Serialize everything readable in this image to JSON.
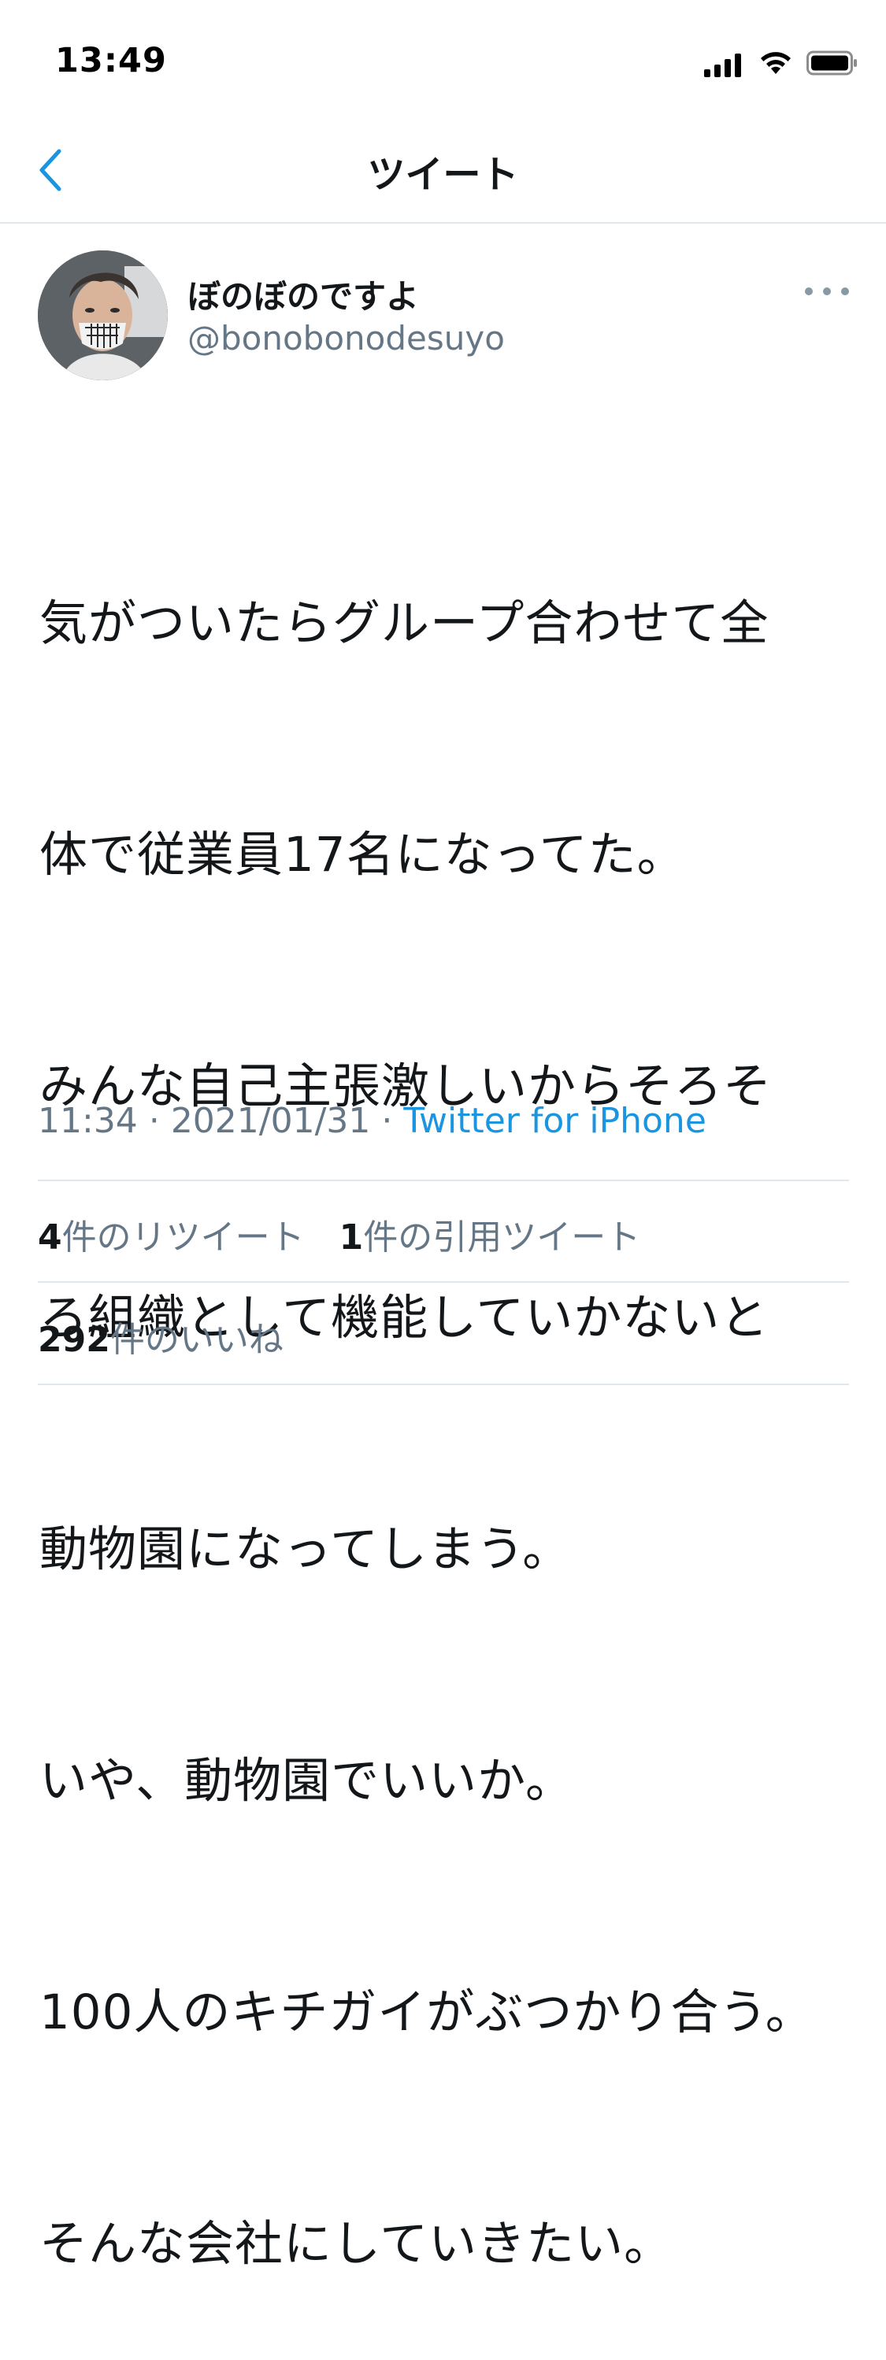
{
  "status_bar": {
    "time": "13:49",
    "icons": [
      "signal-icon",
      "wifi-icon",
      "battery-icon"
    ]
  },
  "nav": {
    "back_icon": "chevron-left-icon",
    "title": "ツイート"
  },
  "tweet": {
    "display_name": "ぼのぼのですよ",
    "handle": "@bonobonodesuyo",
    "more_icon": "more-horizontal-icon",
    "text_lines": [
      "気がついたらグループ合わせて全",
      "体で従業員17名になってた。",
      "みんな自己主張激しいからそろそ",
      "ろ組織として機能していかないと",
      "動物園になってしまう。",
      "いや、動物園でいいか。",
      "100人のキチガイがぶつかり合う。",
      "そんな会社にしていきたい。"
    ],
    "time": "11:34",
    "date": "2021/01/31",
    "separator": "·",
    "source": "Twitter for iPhone"
  },
  "stats": {
    "retweets_count": "4",
    "retweets_label": "件のリツイート",
    "quotes_count": "1",
    "quotes_label": "件の引用ツイート",
    "likes_count": "292",
    "likes_label": "件のいいね"
  },
  "colors": {
    "text": "#14171a",
    "secondary": "#657786",
    "accent": "#1b95e0",
    "divider": "#e1e8ed"
  }
}
